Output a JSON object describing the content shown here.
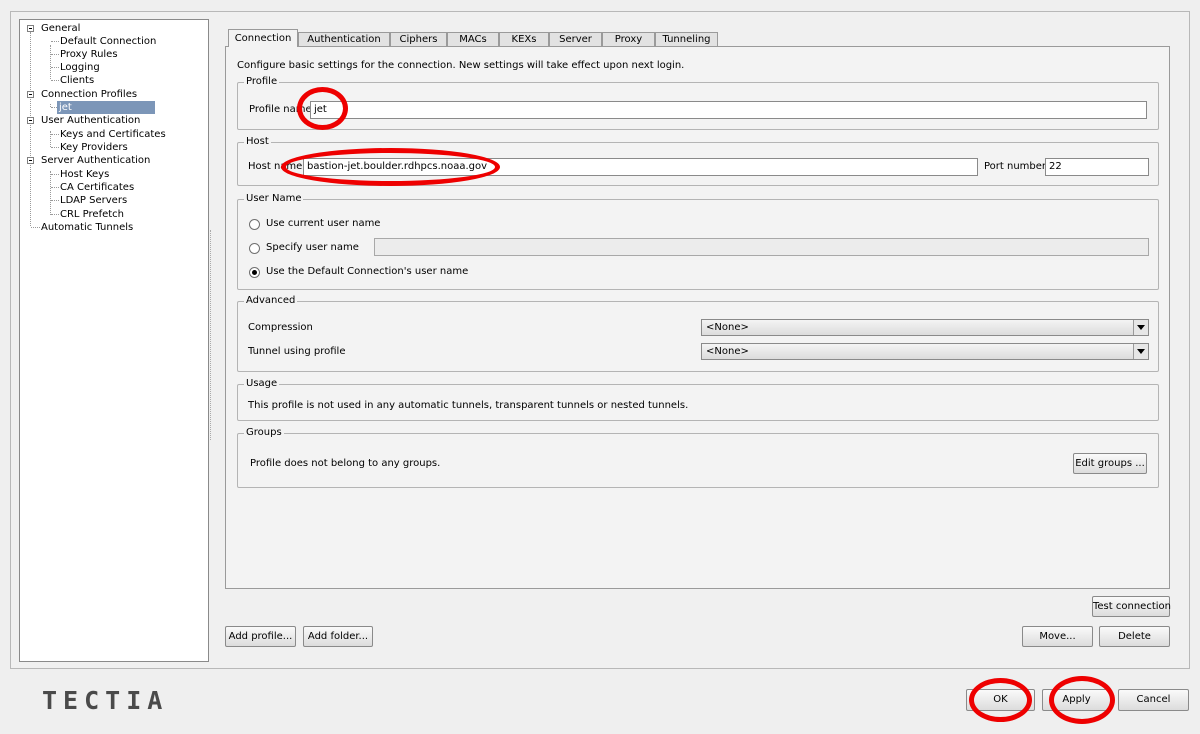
{
  "tree": {
    "general": "General",
    "general_children": [
      "Default Connection",
      "Proxy Rules",
      "Logging",
      "Clients"
    ],
    "connection_profiles": "Connection Profiles",
    "profile_selected": "jet",
    "user_auth": "User Authentication",
    "user_auth_children": [
      "Keys and Certificates",
      "Key Providers"
    ],
    "server_auth": "Server Authentication",
    "server_auth_children": [
      "Host Keys",
      "CA Certificates",
      "LDAP Servers",
      "CRL Prefetch"
    ],
    "auto_tunnels": "Automatic Tunnels"
  },
  "tabs": [
    "Connection",
    "Authentication",
    "Ciphers",
    "MACs",
    "KEXs",
    "Server",
    "Proxy",
    "Tunneling"
  ],
  "intro": "Configure basic settings for the connection. New settings will take effect upon next login.",
  "profile": {
    "group_title": "Profile",
    "name_label": "Profile name",
    "name_value": "jet"
  },
  "host": {
    "group_title": "Host",
    "host_label": "Host name",
    "host_value": "bastion-jet.boulder.rdhpcs.noaa.gov",
    "port_label": "Port number",
    "port_value": "22"
  },
  "username": {
    "group_title": "User Name",
    "opt_current": "Use current user name",
    "opt_specify": "Specify user name",
    "specify_value": "",
    "opt_default": "Use the Default Connection's user name"
  },
  "advanced": {
    "group_title": "Advanced",
    "compression_label": "Compression",
    "compression_value": "<None>",
    "tunnel_label": "Tunnel using profile",
    "tunnel_value": "<None>"
  },
  "usage": {
    "group_title": "Usage",
    "text": "This profile is not used in any automatic tunnels, transparent tunnels or nested tunnels."
  },
  "groups": {
    "group_title": "Groups",
    "text": "Profile does not belong to any groups.",
    "edit_button": "Edit groups ..."
  },
  "buttons": {
    "test_connection": "Test connection",
    "add_profile": "Add profile...",
    "add_folder": "Add folder...",
    "move": "Move...",
    "delete": "Delete",
    "ok": "OK",
    "apply": "Apply",
    "cancel": "Cancel"
  },
  "brand": "TECTIA",
  "colors": {
    "highlight_ring": "#e00000",
    "selection": "#7c96b8"
  }
}
